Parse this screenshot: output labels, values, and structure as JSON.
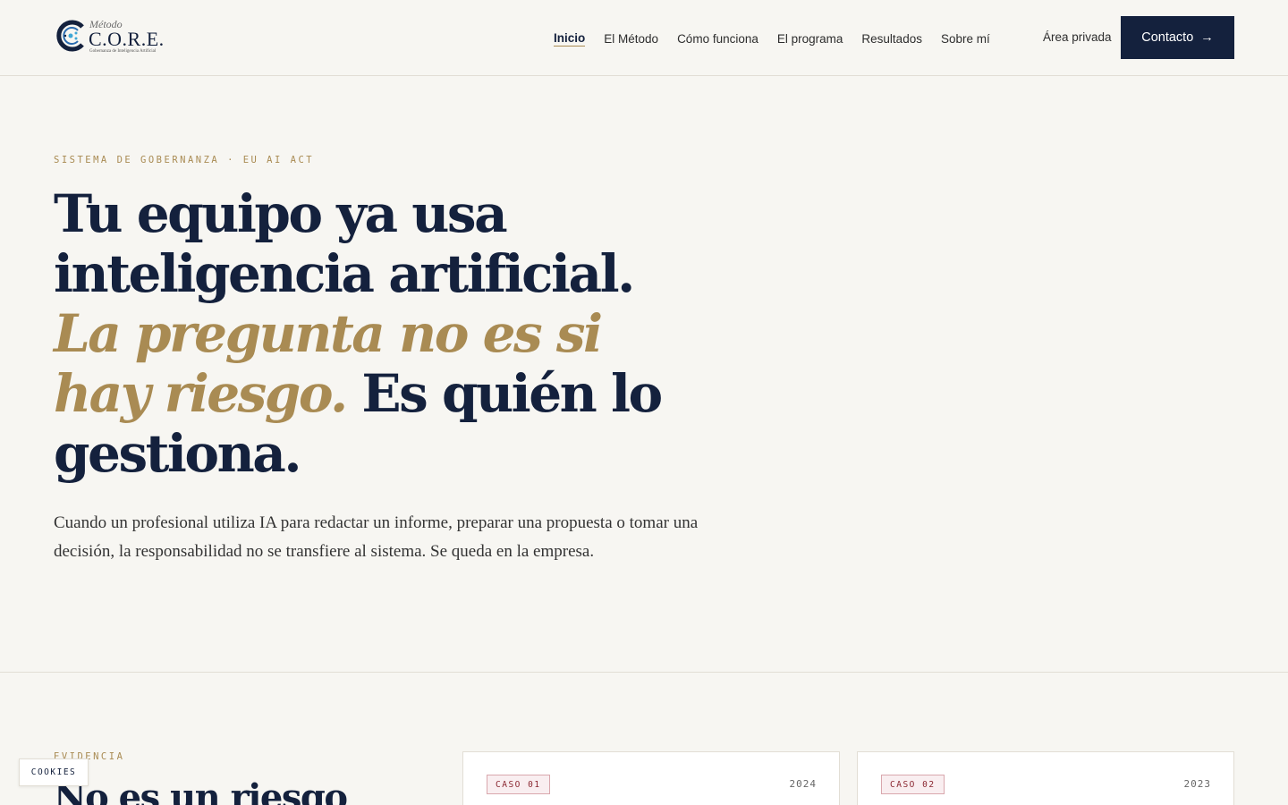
{
  "brand": {
    "small": "Método",
    "name": "C.O.R.E.",
    "tagline": "Gobernanza de Inteligencia Artificial",
    "color_navy": "#14213d",
    "color_gold": "#a98b53"
  },
  "nav": {
    "items": [
      {
        "label": "Inicio",
        "active": true
      },
      {
        "label": "El Método"
      },
      {
        "label": "Cómo funciona"
      },
      {
        "label": "El programa"
      },
      {
        "label": "Resultados"
      },
      {
        "label": "Sobre mí"
      }
    ],
    "private_label": "Área privada",
    "cta_label": "Contacto",
    "cta_arrow": "→"
  },
  "hero": {
    "eyebrow": "SISTEMA DE GOBERNANZA · EU AI ACT",
    "headline_part1": "Tu equipo ya usa inteligencia artificial. ",
    "headline_highlight": "La pregunta no es si hay riesgo.",
    "headline_part2": " Es quién lo gestiona.",
    "lead": "Cuando un profesional utiliza IA para redactar un informe, preparar una propuesta o tomar una decisión, la responsabilidad no se transfiere al sistema. Se queda en la empresa."
  },
  "evidence": {
    "eyebrow": "EVIDENCIA",
    "title": "No es un riesgo",
    "cases": [
      {
        "badge": "CASO 01",
        "year": "2024"
      },
      {
        "badge": "CASO 02",
        "year": "2023"
      }
    ]
  },
  "cookie": {
    "label": "COOKIES"
  }
}
